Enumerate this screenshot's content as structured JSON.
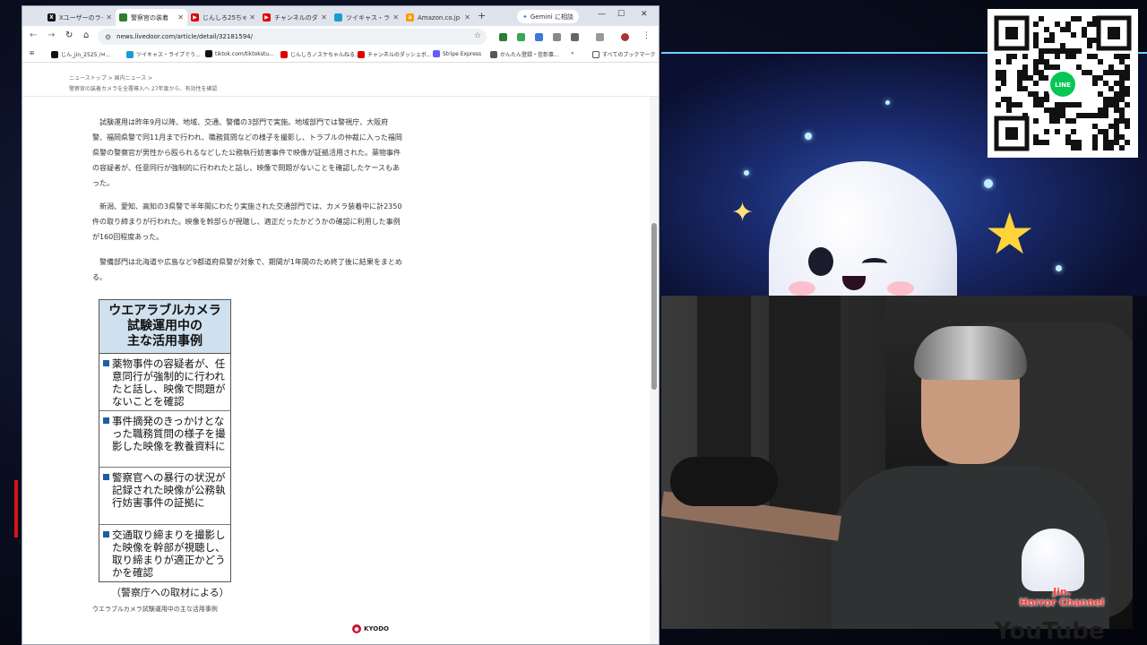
{
  "browser": {
    "tabs": [
      {
        "title": "Xユーザーのライ",
        "favicon": "x-icon",
        "color": "#111111"
      },
      {
        "title": "警察官の装着",
        "favicon": "livedoor-icon",
        "color": "#2e7d32",
        "active": true
      },
      {
        "title": "じんしろ25ちゃ",
        "favicon": "youtube-icon",
        "color": "#e00000"
      },
      {
        "title": "チャンネルのダ",
        "favicon": "youtube-icon",
        "color": "#e00000"
      },
      {
        "title": "ツイキャス・ライ",
        "favicon": "twitcasting-icon",
        "color": "#1b9bd1"
      },
      {
        "title": "Amazon.co.jp",
        "favicon": "amazon-icon",
        "color": "#ff9900"
      }
    ],
    "new_tab": "+",
    "gemini_button": "Gemini に相談",
    "url": "news.livedoor.com/article/detail/32181594/",
    "bookmarks": [
      {
        "label": "じん_jin_2525 /ㅂ...",
        "color": "#111111"
      },
      {
        "label": "ツイキャス・ライブでう...",
        "color": "#1b9bd1"
      },
      {
        "label": "tiktok.com/tiktokstu...",
        "color": "#111111"
      },
      {
        "label": "じんしろノスケちゃんねる...",
        "color": "#e00000"
      },
      {
        "label": "チャンネルのダッシュボ...",
        "color": "#e00000"
      },
      {
        "label": "Stripe Express",
        "color": "#635bff"
      },
      {
        "label": "かんたん登録・信彰事...",
        "color": "#555555"
      }
    ],
    "bookmarks_more": "»",
    "all_bookmarks": "すべてのブックマーク"
  },
  "article": {
    "breadcrumb": "ニューストップ  >  国内ニュース  >",
    "headline_sub": "警察官の装着カメラを全署導入へ 27年度から、有効性を確認",
    "paragraphs": [
      "試験運用は昨年9月以降、地域、交通、警備の3部門で実施。地域部門では警視庁、大阪府警、福岡県警で同11月まで行われ、職務質問などの様子を撮影し、トラブルの仲裁に入った福岡県警の警察官が男性から殴られるなどした公務執行妨害事件で映像が証拠活用された。薬物事件の容疑者が、任意同行が強制的に行われたと話し、映像で問題がないことを確認したケースもあった。",
      "新潟、愛知、高知の3県警で半年間にわたり実施された交通部門では、カメラ装着中に計2350件の取り締まりが行われた。映像を幹部らが視聴し、適正だったかどうかの確認に利用した事例が160回程度あった。",
      "警備部門は北海道や広島など9都道府県警が対象で、期間が1年間のため終了後に結果をまとめる。"
    ],
    "infobox": {
      "title_lines": [
        "ウエアラブルカメラ",
        "試験運用中の",
        "主な活用事例"
      ],
      "items": [
        "薬物事件の容疑者が、任意同行が強制的に行われたと話し、映像で問題がないことを確認",
        "事件摘発のきっかけとなった職務質問の様子を撮影した映像を教養資料に",
        "警察官への暴行の状況が記録された映像が公務執行妨害事件の証拠に",
        "交通取り締まりを撮影した映像を幹部が視聴し、取り締まりが適正かどうかを確認"
      ],
      "credit": "（警察庁への取材による）"
    },
    "caption": "ウエラブルカメラ試験運用中の主な活用事例",
    "source": "KYODO"
  },
  "stream": {
    "qr_badge": "LINE",
    "channel_name_lines": [
      "Jin.",
      "Horror Channel"
    ],
    "platform": "YouTube",
    "accent": "#6fd4ff"
  }
}
